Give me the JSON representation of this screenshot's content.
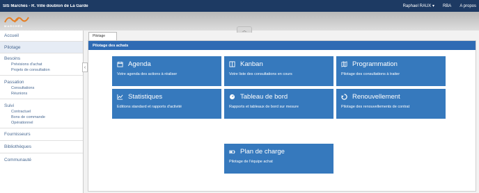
{
  "topbar": {
    "title": "SIS Marchés - R. Ville doublon de La Garde",
    "user": "Raphael RAUX",
    "user_caret": "▾",
    "link_rba": "RBA",
    "link_about": "A propos"
  },
  "logo": {
    "wordmark": "MARCHÉS"
  },
  "collapse_glyph": "︿",
  "sidebar": {
    "accueil": "Accueil",
    "pilotage": "Pilotage",
    "besoins": {
      "label": "Besoins",
      "items": [
        "Prévisions d'achat",
        "Projets de consultation"
      ]
    },
    "passation": {
      "label": "Passation",
      "items": [
        "Consultations",
        "Réunions"
      ]
    },
    "suivi": {
      "label": "Suivi",
      "items": [
        "Contractuel",
        "Bons de commande",
        "Opérationnel"
      ]
    },
    "fournisseurs": "Fournisseurs",
    "bibliotheques": "Bibliothèques",
    "communaute": "Communauté",
    "toggle_glyph": "‹"
  },
  "tabs": [
    "Pilotage"
  ],
  "panel": {
    "title": "Pilotage des achats"
  },
  "tiles": [
    {
      "title": "Agenda",
      "desc": "Votre agenda des actions à réaliser",
      "icon": "calendar-icon"
    },
    {
      "title": "Kanban",
      "desc": "Votre liste des consultations en cours",
      "icon": "kanban-icon"
    },
    {
      "title": "Programmation",
      "desc": "Pilotage des consultations à traiter",
      "icon": "map-icon"
    },
    {
      "title": "Statistiques",
      "desc": "Editions standard et rapports d'activité",
      "icon": "line-chart-icon"
    },
    {
      "title": "Tableau de bord",
      "desc": "Rapports et tableaux de bord sur mesure",
      "icon": "dashboard-icon"
    },
    {
      "title": "Renouvellement",
      "desc": "Pilotage des renouvellements de contrat",
      "icon": "recycle-icon"
    },
    {
      "title": "Plan de charge",
      "desc": "Pilotage de l'équipe achat",
      "icon": "battery-icon"
    }
  ],
  "colors": {
    "topbar": "#1d3a63",
    "accent": "#3679bd",
    "panel_header": "#2f6bb4",
    "link": "#4a6a93"
  }
}
